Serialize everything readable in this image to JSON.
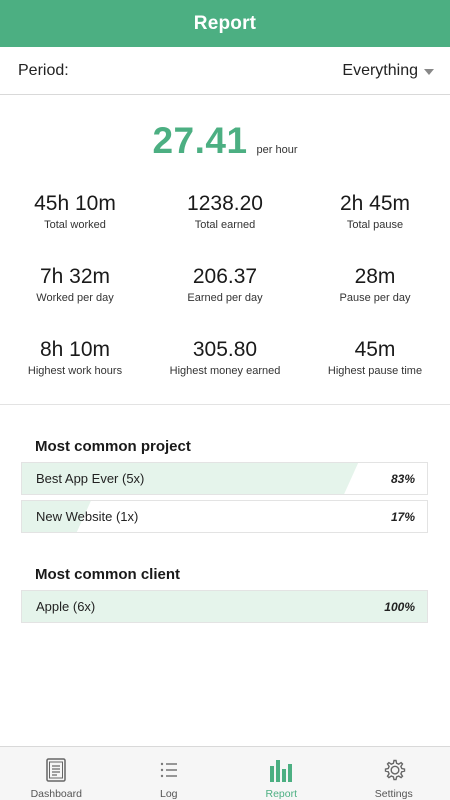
{
  "header": {
    "title": "Report"
  },
  "period": {
    "label": "Period:",
    "value": "Everything"
  },
  "rate": {
    "value": "27.41",
    "unit": "per hour"
  },
  "stats": [
    [
      {
        "value": "45h 10m",
        "label": "Total worked"
      },
      {
        "value": "1238.20",
        "label": "Total earned"
      },
      {
        "value": "2h 45m",
        "label": "Total pause"
      }
    ],
    [
      {
        "value": "7h 32m",
        "label": "Worked per day"
      },
      {
        "value": "206.37",
        "label": "Earned per day"
      },
      {
        "value": "28m",
        "label": "Pause per day"
      }
    ],
    [
      {
        "value": "8h 10m",
        "label": "Highest work hours"
      },
      {
        "value": "305.80",
        "label": "Highest money earned"
      },
      {
        "value": "45m",
        "label": "Highest pause time"
      }
    ]
  ],
  "projects": {
    "title": "Most common project",
    "items": [
      {
        "label": "Best App Ever (5x)",
        "percent": "83%",
        "share": 0.83
      },
      {
        "label": "New Website (1x)",
        "percent": "17%",
        "share": 0.17
      }
    ]
  },
  "clients": {
    "title": "Most common client",
    "items": [
      {
        "label": "Apple (6x)",
        "percent": "100%",
        "share": 1.0
      }
    ]
  },
  "nav": {
    "items": [
      {
        "label": "Dashboard",
        "icon": "dashboard-icon",
        "active": false
      },
      {
        "label": "Log",
        "icon": "list-icon",
        "active": false
      },
      {
        "label": "Report",
        "icon": "bar-chart-icon",
        "active": true
      },
      {
        "label": "Settings",
        "icon": "gear-icon",
        "active": false
      }
    ]
  },
  "colors": {
    "accent": "#4caf82",
    "bar_fill": "#e5f4eb"
  }
}
